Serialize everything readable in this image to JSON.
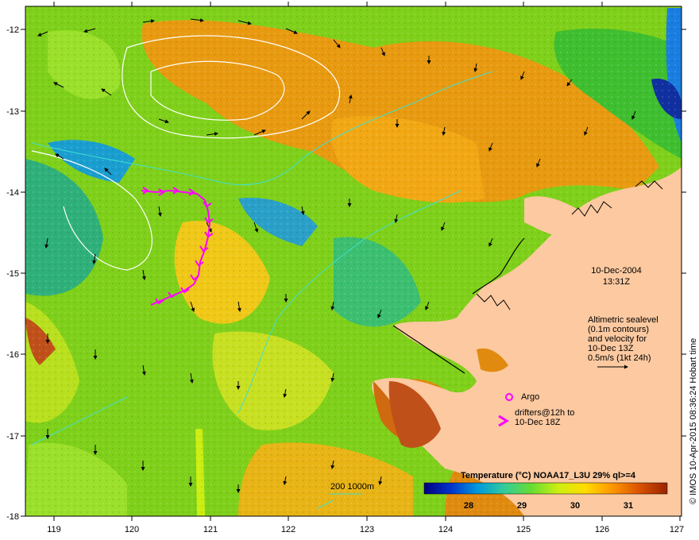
{
  "map": {
    "lon_ticks": [
      "119",
      "120",
      "121",
      "122",
      "123",
      "124",
      "125",
      "126",
      "127"
    ],
    "lat_ticks": [
      "-12",
      "-13",
      "-14",
      "-15",
      "-16",
      "-17",
      "-18"
    ],
    "date": "10-Dec-2004",
    "time": "13:31Z",
    "notes": [
      "Altimetric sealevel",
      "(0.1m contours)",
      "and velocity for",
      "10-Dec 13Z",
      "0.5m/s (1kt 24h)"
    ],
    "legend_argo": "Argo",
    "legend_drifters": [
      "drifters@12h to",
      "10-Dec 18Z"
    ],
    "depth_legend": "200  1000m",
    "colorbar": {
      "title": "Temperature (°C) NOAA17_L3U 29% ql>=4",
      "ticks": [
        "28",
        "29",
        "30",
        "31"
      ],
      "ramp": [
        "#00007f",
        "#0033cc",
        "#0099dd",
        "#33cc99",
        "#66dd33",
        "#ccee11",
        "#ffdd00",
        "#ff9900",
        "#dd5500",
        "#992200"
      ]
    },
    "credit": "© IMOS 10-Apr-2015 08:36:24 Hobart time",
    "colors": {
      "land": "#fcc9a0",
      "ocean_warm": "#e89a10",
      "ocean_mid": "#7fd01a",
      "drifter": "#ff00ff",
      "isobath": "#40e0d0",
      "contour": "#ffffff"
    }
  }
}
